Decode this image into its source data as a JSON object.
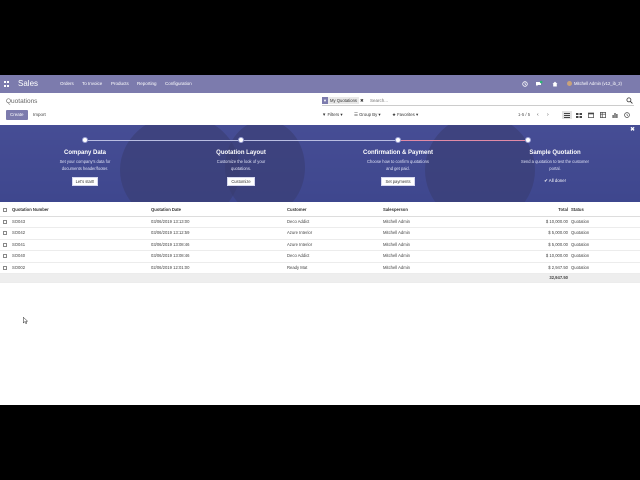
{
  "navbar": {
    "app_name": "Sales",
    "menu": [
      "Orders",
      "To Invoice",
      "Products",
      "Reporting",
      "Configuration"
    ],
    "user_label": "Mitchell Admin (v12_ib_2)"
  },
  "control_panel": {
    "breadcrumb": "Quotations",
    "create_label": "Create",
    "import_label": "Import",
    "search_facet": "My Quotations",
    "search_placeholder": "Search...",
    "filters_label": "Filters",
    "group_by_label": "Group By",
    "favorites_label": "Favorites",
    "pager_value": "1-5 / 5"
  },
  "onboarding": {
    "steps": [
      {
        "title": "Company Data",
        "desc1": "Set your company's data for",
        "desc2": "documents header/footer.",
        "button": "Let's start!"
      },
      {
        "title": "Quotation Layout",
        "desc1": "Customize the look of your",
        "desc2": "quotations.",
        "button": "Customize"
      },
      {
        "title": "Confirmation & Payment",
        "desc1": "Choose how to confirm quotations",
        "desc2": "and get paid.",
        "button": "Set payments"
      },
      {
        "title": "Sample Quotation",
        "desc1": "Send a quotation to test the customer",
        "desc2": "portal.",
        "done": "All done!"
      }
    ]
  },
  "table": {
    "columns": {
      "number": "Quotation Number",
      "date": "Quotation Date",
      "customer": "Customer",
      "salesperson": "Salesperson",
      "total": "Total",
      "status": "Status"
    },
    "rows": [
      {
        "number": "SO043",
        "date": "03/06/2019 13:13:00",
        "customer": "Deco Addict",
        "salesperson": "Mitchell Admin",
        "total": "$ 10,000.00",
        "status": "Quotation"
      },
      {
        "number": "SO042",
        "date": "03/06/2019 13:12:59",
        "customer": "Azure Interior",
        "salesperson": "Mitchell Admin",
        "total": "$ 5,000.00",
        "status": "Quotation"
      },
      {
        "number": "SO041",
        "date": "03/06/2019 13:08:46",
        "customer": "Azure Interior",
        "salesperson": "Mitchell Admin",
        "total": "$ 5,000.00",
        "status": "Quotation"
      },
      {
        "number": "SO040",
        "date": "03/06/2019 13:08:46",
        "customer": "Deco Addict",
        "salesperson": "Mitchell Admin",
        "total": "$ 10,000.00",
        "status": "Quotation"
      },
      {
        "number": "SO002",
        "date": "02/06/2019 12:01:00",
        "customer": "Ready Mat",
        "salesperson": "Mitchell Admin",
        "total": "$ 2,947.50",
        "status": "Quotation"
      }
    ],
    "footer_total": "32,947.50"
  },
  "colors": {
    "brand": "#7c7bad",
    "banner": "#3b4385"
  }
}
